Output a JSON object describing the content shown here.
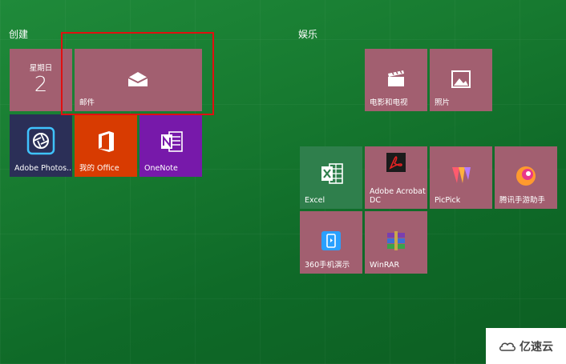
{
  "groups": {
    "create_title": "创建",
    "entertainment_title": "娱乐"
  },
  "tiles": {
    "calendar": {
      "day": "星期日",
      "date": "2"
    },
    "mail": {
      "label": "邮件"
    },
    "photoshop": {
      "label": "Adobe Photos..."
    },
    "office": {
      "label": "我的 Office"
    },
    "onenote": {
      "label": "OneNote"
    },
    "movies": {
      "label": "电影和电视"
    },
    "photos": {
      "label": "照片"
    },
    "excel": {
      "label": "Excel"
    },
    "acrobat": {
      "label": "Adobe Acrobat DC"
    },
    "picpick": {
      "label": "PicPick"
    },
    "tencent": {
      "label": "腾讯手游助手"
    },
    "demo360": {
      "label": "360手机演示"
    },
    "winrar": {
      "label": "WinRAR"
    }
  },
  "watermark": {
    "text": "亿速云"
  },
  "colors": {
    "tile_pink": "#a25f70",
    "photoshop_bg": "#2b2f57",
    "office_bg": "#d83b01",
    "onenote_bg": "#7719aa",
    "excel_bg": "#2f7f4c",
    "highlight_border": "#e01010"
  }
}
